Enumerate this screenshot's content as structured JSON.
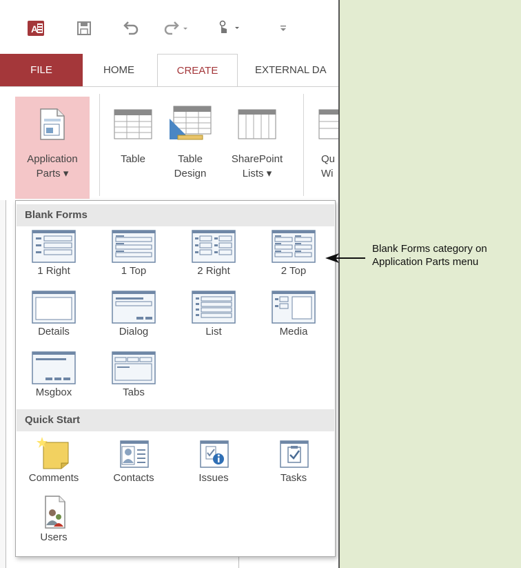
{
  "colors": {
    "accent": "#a4373a",
    "selected_bg": "#f4c6c8",
    "page_bg": "#e3ecd1"
  },
  "toolbar": {
    "icons": [
      "access-logo-icon",
      "save-icon",
      "undo-icon",
      "redo-icon",
      "touch-mode-icon",
      "customize-qat-icon"
    ]
  },
  "tabs": [
    {
      "label": "FILE"
    },
    {
      "label": "HOME"
    },
    {
      "label": "CREATE"
    },
    {
      "label": "EXTERNAL DA"
    }
  ],
  "ribbon": {
    "buttons": [
      {
        "line1": "Application",
        "line2": "Parts ▾"
      },
      {
        "line1": "Table",
        "line2": ""
      },
      {
        "line1": "Table",
        "line2": "Design"
      },
      {
        "line1": "SharePoint",
        "line2": "Lists ▾"
      },
      {
        "line1": "Qu",
        "line2": "Wi"
      }
    ]
  },
  "menu": {
    "blank_forms": {
      "heading": "Blank Forms",
      "items": [
        "1 Right",
        "1 Top",
        "2 Right",
        "2 Top",
        "Details",
        "Dialog",
        "List",
        "Media",
        "Msgbox",
        "Tabs"
      ]
    },
    "quick_start": {
      "heading": "Quick Start",
      "items": [
        "Comments",
        "Contacts",
        "Issues",
        "Tasks",
        "Users"
      ]
    }
  },
  "callout": {
    "line1": "Blank Forms category on",
    "line2": "Application Parts menu"
  }
}
